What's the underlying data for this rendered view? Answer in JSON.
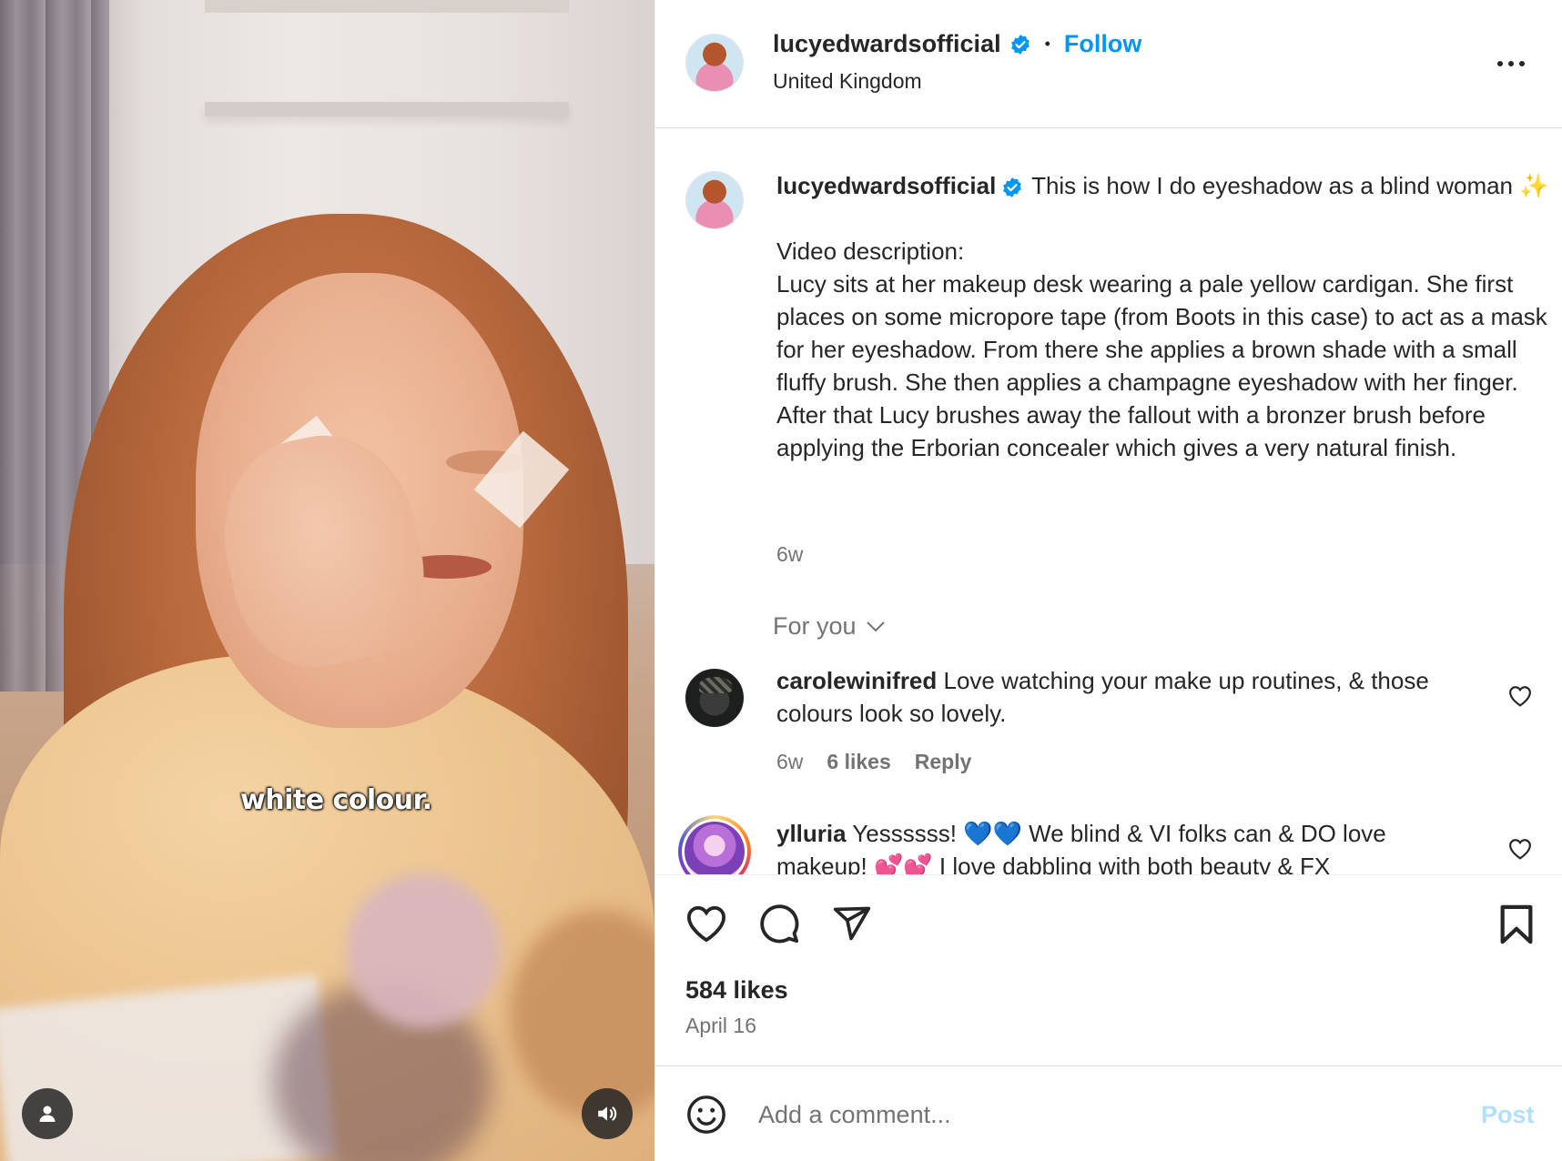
{
  "video": {
    "subtitle": "white colour.",
    "user_tag_icon": "person-icon",
    "mute_icon": "speaker-icon"
  },
  "post": {
    "username": "lucyedwardsofficial",
    "location": "United Kingdom",
    "follow_label": "Follow",
    "separator": "•",
    "more_icon": "more-horizontal-icon",
    "caption_username": "lucyedwardsofficial",
    "caption_text": " This is how I do eyeshadow as a blind woman ✨\n\nVideo description:\nLucy sits at her makeup desk wearing a pale yellow cardigan. She first places on some micropore tape (from Boots in this case) to act as a mask for her eyeshadow. From there she applies a brown shade with a small fluffy brush. She then applies a champagne eyeshadow with her finger. After that Lucy brushes away the fallout with a bronzer brush before applying the Erborian concealer which gives a very natural finish.",
    "caption_time": "6w",
    "sort_label": "For you",
    "comments": [
      {
        "username": "carolewinifred",
        "text": " Love watching your make up routines, & those colours look so lovely.",
        "time": "6w",
        "likes": "6 likes",
        "reply": "Reply"
      },
      {
        "username": "ylluria",
        "text": " Yessssss! 💙💙 We blind & VI folks can & DO love makeup! 💕💕 I love dabbling with both beauty & FX"
      }
    ],
    "likes": "584 likes",
    "date": "April 16",
    "comment_placeholder": "Add a comment...",
    "post_button": "Post"
  },
  "colors": {
    "accent": "#0095f6",
    "verified": "#0095f6",
    "text": "#262626",
    "muted": "#737373",
    "post_disabled": "#b2dffc"
  }
}
